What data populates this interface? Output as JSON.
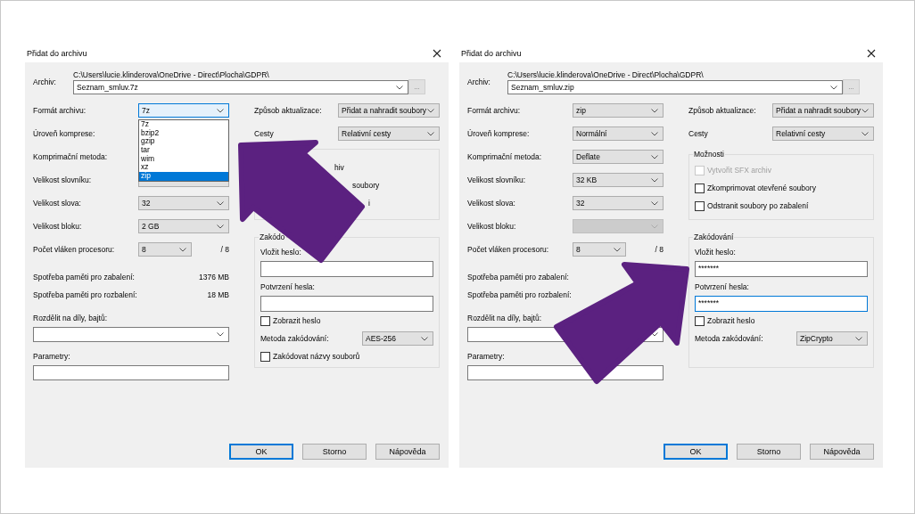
{
  "dialogs": [
    {
      "title": "Přidat do archivu",
      "archive": {
        "label": "Archiv:",
        "path": "C:\\Users\\lucie.klinderova\\OneDrive - Direct\\Plocha\\GDPR\\",
        "name": "Seznam_smluv.7z",
        "browse": "..."
      },
      "settings": [
        {
          "label": "Formát archivu:",
          "kind": "select",
          "control": {
            "value": "7z",
            "focused": true,
            "disabled": false
          },
          "list": [
            {
              "label": "7z",
              "selected": false
            },
            {
              "label": "bzip2",
              "selected": false
            },
            {
              "label": "gzip",
              "selected": false
            },
            {
              "label": "tar",
              "selected": false
            },
            {
              "label": "wim",
              "selected": false
            },
            {
              "label": "xz",
              "selected": false
            },
            {
              "label": "zip",
              "selected": true
            }
          ]
        },
        {
          "label": "Úroveň komprese:",
          "kind": "label_only"
        },
        {
          "label": "Komprimační metoda:",
          "kind": "label_only"
        },
        {
          "label": "Velikost slovníku:",
          "kind": "select",
          "control": {
            "focused": false,
            "disabled": false
          }
        },
        {
          "label": "Velikost slova:",
          "kind": "select",
          "control": {
            "value": "32",
            "focused": false,
            "disabled": false
          }
        },
        {
          "label": "Velikost bloku:",
          "kind": "select",
          "control": {
            "value": "2 GB",
            "focused": false,
            "disabled": false
          }
        },
        {
          "label": "Počet vláken procesoru:",
          "kind": "short_select",
          "control": {
            "value": "8",
            "focused": false,
            "disabled": false
          },
          "suffix": "/ 8"
        }
      ],
      "memory": [
        {
          "label": "Spotřeba paměti pro zabalení:",
          "value": "1376 MB"
        },
        {
          "label": "Spotřeba paměti pro rozbalení:",
          "value": "18 MB"
        }
      ],
      "split": {
        "label": "Rozdělit na díly, bajtů:"
      },
      "params": {
        "label": "Parametry:"
      },
      "right_settings": [
        {
          "label": "Způsob aktualizace:",
          "value": "Přidat a nahradit soubory"
        },
        {
          "label": "Cesty",
          "value": "Relativní cesty"
        }
      ],
      "options": {
        "items": [
          {
            "label": "hiv"
          },
          {
            "label": "soubory"
          },
          {
            "label": "i"
          }
        ]
      },
      "encryption": {
        "title": "Zakódo",
        "password_label": "Vložit heslo:",
        "password": {
          "focused": false
        },
        "confirm_label": "Potvrzení hesla:",
        "confirm": {
          "focused": false
        },
        "show": {
          "label": "Zobrazit heslo",
          "checked": false
        },
        "method": {
          "label": "Metoda zakódování:",
          "value": "AES-256"
        },
        "encrypt_names": {
          "label": "Zakódovat názvy souborů",
          "checked": false
        }
      },
      "buttons": [
        {
          "label": "OK",
          "default": true
        },
        {
          "label": "Storno",
          "default": false
        },
        {
          "label": "Nápověda",
          "default": false
        }
      ],
      "arrow": {
        "kind": "up_left"
      }
    },
    {
      "title": "Přidat do archivu",
      "archive": {
        "label": "Archiv:",
        "path": "C:\\Users\\lucie.klinderova\\OneDrive - Direct\\Plocha\\GDPR\\",
        "name": "Seznam_smluv.zip",
        "browse": "..."
      },
      "settings": [
        {
          "label": "Formát archivu:",
          "kind": "select",
          "control": {
            "value": "zip",
            "focused": false,
            "disabled": false
          }
        },
        {
          "label": "Úroveň komprese:",
          "kind": "select",
          "control": {
            "value": "Normální",
            "focused": false,
            "disabled": false
          }
        },
        {
          "label": "Komprimační metoda:",
          "kind": "select",
          "control": {
            "value": "Deflate",
            "focused": false,
            "disabled": false
          }
        },
        {
          "label": "Velikost slovníku:",
          "kind": "select",
          "control": {
            "value": "32 KB",
            "focused": false,
            "disabled": false
          }
        },
        {
          "label": "Velikost slova:",
          "kind": "select",
          "control": {
            "value": "32",
            "focused": false,
            "disabled": false
          }
        },
        {
          "label": "Velikost bloku:",
          "kind": "select",
          "control": {
            "focused": false,
            "disabled": true
          }
        },
        {
          "label": "Počet vláken procesoru:",
          "kind": "short_select",
          "control": {
            "value": "8",
            "focused": false,
            "disabled": false
          },
          "suffix": "/ 8"
        }
      ],
      "memory": [
        {
          "label": "Spotřeba paměti pro zabalení:"
        },
        {
          "label": "Spotřeba paměti pro rozbalení:"
        }
      ],
      "split": {
        "label": "Rozdělit na díly, bajtů:"
      },
      "params": {
        "label": "Parametry:"
      },
      "right_settings": [
        {
          "label": "Způsob aktualizace:",
          "value": "Přidat a nahradit soubory"
        },
        {
          "label": "Cesty",
          "value": "Relativní cesty"
        }
      ],
      "options": {
        "title": "Možnosti",
        "items": [
          {
            "label": "Vytvořit SFX archiv",
            "checked": false,
            "disabled": true
          },
          {
            "label": "Zkomprimovat otevřené soubory",
            "checked": false,
            "disabled": false
          },
          {
            "label": "Odstranit soubory po zabalení",
            "checked": false,
            "disabled": false
          }
        ]
      },
      "encryption": {
        "title": "Zakódování",
        "password_label": "Vložit heslo:",
        "password": {
          "value": "*******",
          "focused": false
        },
        "confirm_label": "Potvrzení hesla:",
        "confirm": {
          "value": "*******",
          "focused": true
        },
        "show": {
          "label": "Zobrazit heslo",
          "checked": false
        },
        "method": {
          "label": "Metoda zakódování:",
          "value": "ZipCrypto"
        }
      },
      "buttons": [
        {
          "label": "OK",
          "default": true
        },
        {
          "label": "Storno",
          "default": false
        },
        {
          "label": "Nápověda",
          "default": false
        }
      ],
      "arrow": {
        "kind": "up_right"
      }
    }
  ]
}
